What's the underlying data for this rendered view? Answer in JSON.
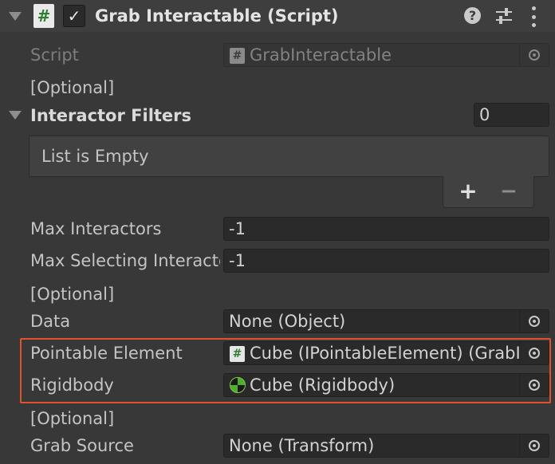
{
  "header": {
    "title": "Grab Interactable (Script)",
    "enabled_checked": true,
    "icons": {
      "foldout": "foldout-expanded-icon",
      "component": "csharp-script-icon",
      "help": "help-icon",
      "presets": "preset-sliders-icon",
      "menu": "kebab-menu-icon"
    }
  },
  "fields": {
    "script": {
      "label": "Script",
      "value": "GrabInteractable"
    },
    "optional_1": "[Optional]",
    "interactor_filters": {
      "label": "Interactor Filters",
      "count": "0",
      "empty_text": "List is Empty",
      "add": "+",
      "remove": "−"
    },
    "max_interactors": {
      "label": "Max Interactors",
      "value": "-1"
    },
    "max_selecting": {
      "label": "Max Selecting Interactors",
      "value": "-1"
    },
    "optional_2": "[Optional]",
    "data": {
      "label": "Data",
      "value": "None (Object)"
    },
    "pointable_element": {
      "label": "Pointable Element",
      "value": "Cube (IPointableElement) (GrabInteractable)"
    },
    "rigidbody": {
      "label": "Rigidbody",
      "value": "Cube (Rigidbody)"
    },
    "optional_3": "[Optional]",
    "grab_source": {
      "label": "Grab Source",
      "value": "None (Transform)"
    }
  },
  "colors": {
    "background": "#383838",
    "field_bg": "#2a2a2a",
    "highlight_border": "#e0522e",
    "script_icon_green": "#2e7d32"
  }
}
